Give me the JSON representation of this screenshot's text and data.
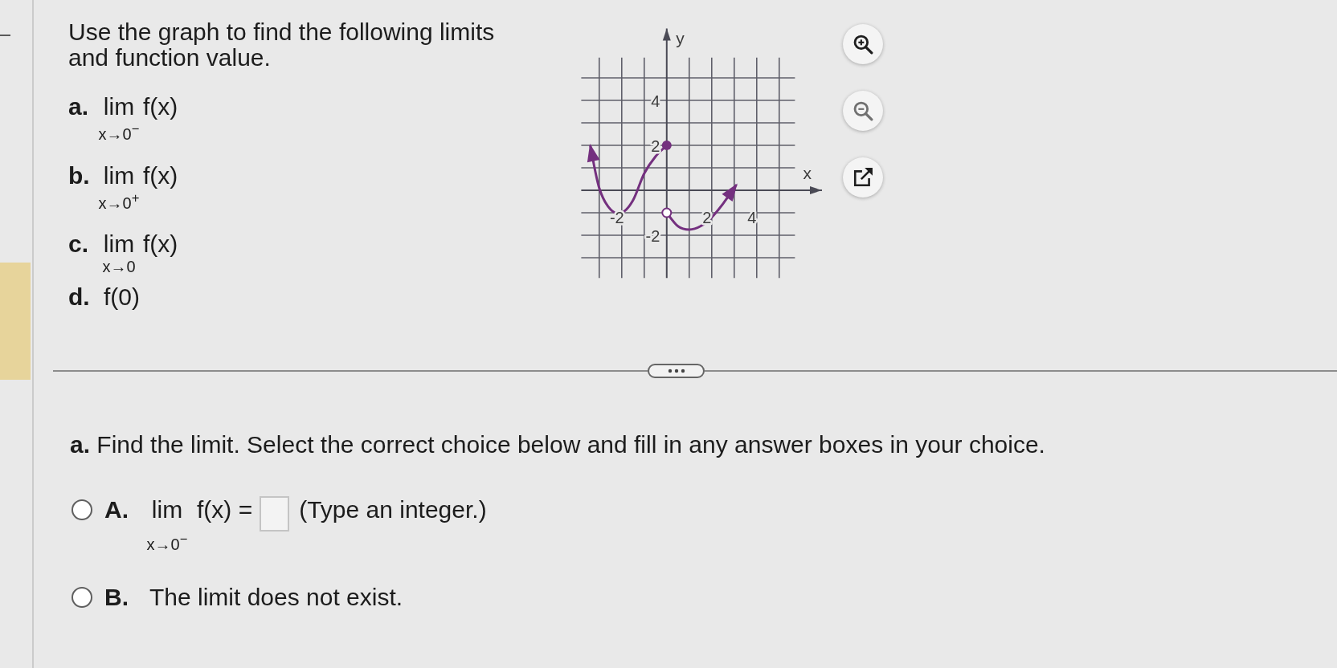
{
  "problem": {
    "prompt": "Use the graph to find the following limits and function value.",
    "parts": [
      {
        "kind": "limit",
        "letter": "a.",
        "operator": "lim",
        "function": "f(x)",
        "approach": "x→0$^{−}$"
      },
      {
        "kind": "limit",
        "letter": "b.",
        "operator": "lim",
        "function": "f(x)",
        "approach": "x→0$^{+}$"
      },
      {
        "kind": "limit",
        "letter": "c.",
        "operator": "lim",
        "function": "f(x)",
        "approach": "x→0"
      },
      {
        "kind": "value",
        "letter": "d.",
        "expression": "f(0)"
      }
    ]
  },
  "graph": {
    "chart_data": {
      "type": "line",
      "xlabel": "x",
      "ylabel": "y",
      "x": [
        -3.4,
        -3,
        -2.5,
        -2,
        -1.5,
        -1,
        -0.5,
        0,
        0,
        0.5,
        1,
        1.5,
        2,
        2.5,
        3.1
      ],
      "series": [
        {
          "color": "#74307f",
          "values": [
            2,
            0.1,
            -0.85,
            -1,
            -0.45,
            0.75,
            1.5,
            2,
            null,
            null,
            null,
            null,
            null,
            null,
            null
          ]
        },
        {
          "color": "#74307f",
          "values": [
            null,
            null,
            null,
            null,
            null,
            null,
            null,
            null,
            -1,
            -1.6,
            -1.75,
            -1.6,
            -1.2,
            -0.6,
            0.25
          ]
        }
      ],
      "xlim": [
        -3.8,
        6.9
      ],
      "ylim": [
        -3.9,
        7.2
      ],
      "xticks": [
        -2,
        2,
        4
      ],
      "yticks": [
        -2,
        2,
        4
      ],
      "grid": true
    },
    "endpoints": [
      {
        "filled": true
      },
      {
        "filled": false
      }
    ],
    "tools": [
      {
        "kind": "zoomin",
        "disabled": false
      },
      {
        "kind": "zoomout",
        "disabled": true
      },
      {
        "kind": "popout",
        "disabled": false
      }
    ]
  },
  "question": {
    "text": "**a.** Find the limit. Select the correct choice below and fill in any answer boxes in your choice.",
    "choices": [
      {
        "kind": "limit",
        "letter": "A.",
        "selected": false,
        "operator": "lim",
        "expression": "f(x) =",
        "approach": "x→0$^{−}$",
        "hint": "(Type an integer.)"
      },
      {
        "kind": "statement",
        "letter": "B.",
        "selected": false,
        "text": "The limit does not exist."
      }
    ]
  }
}
